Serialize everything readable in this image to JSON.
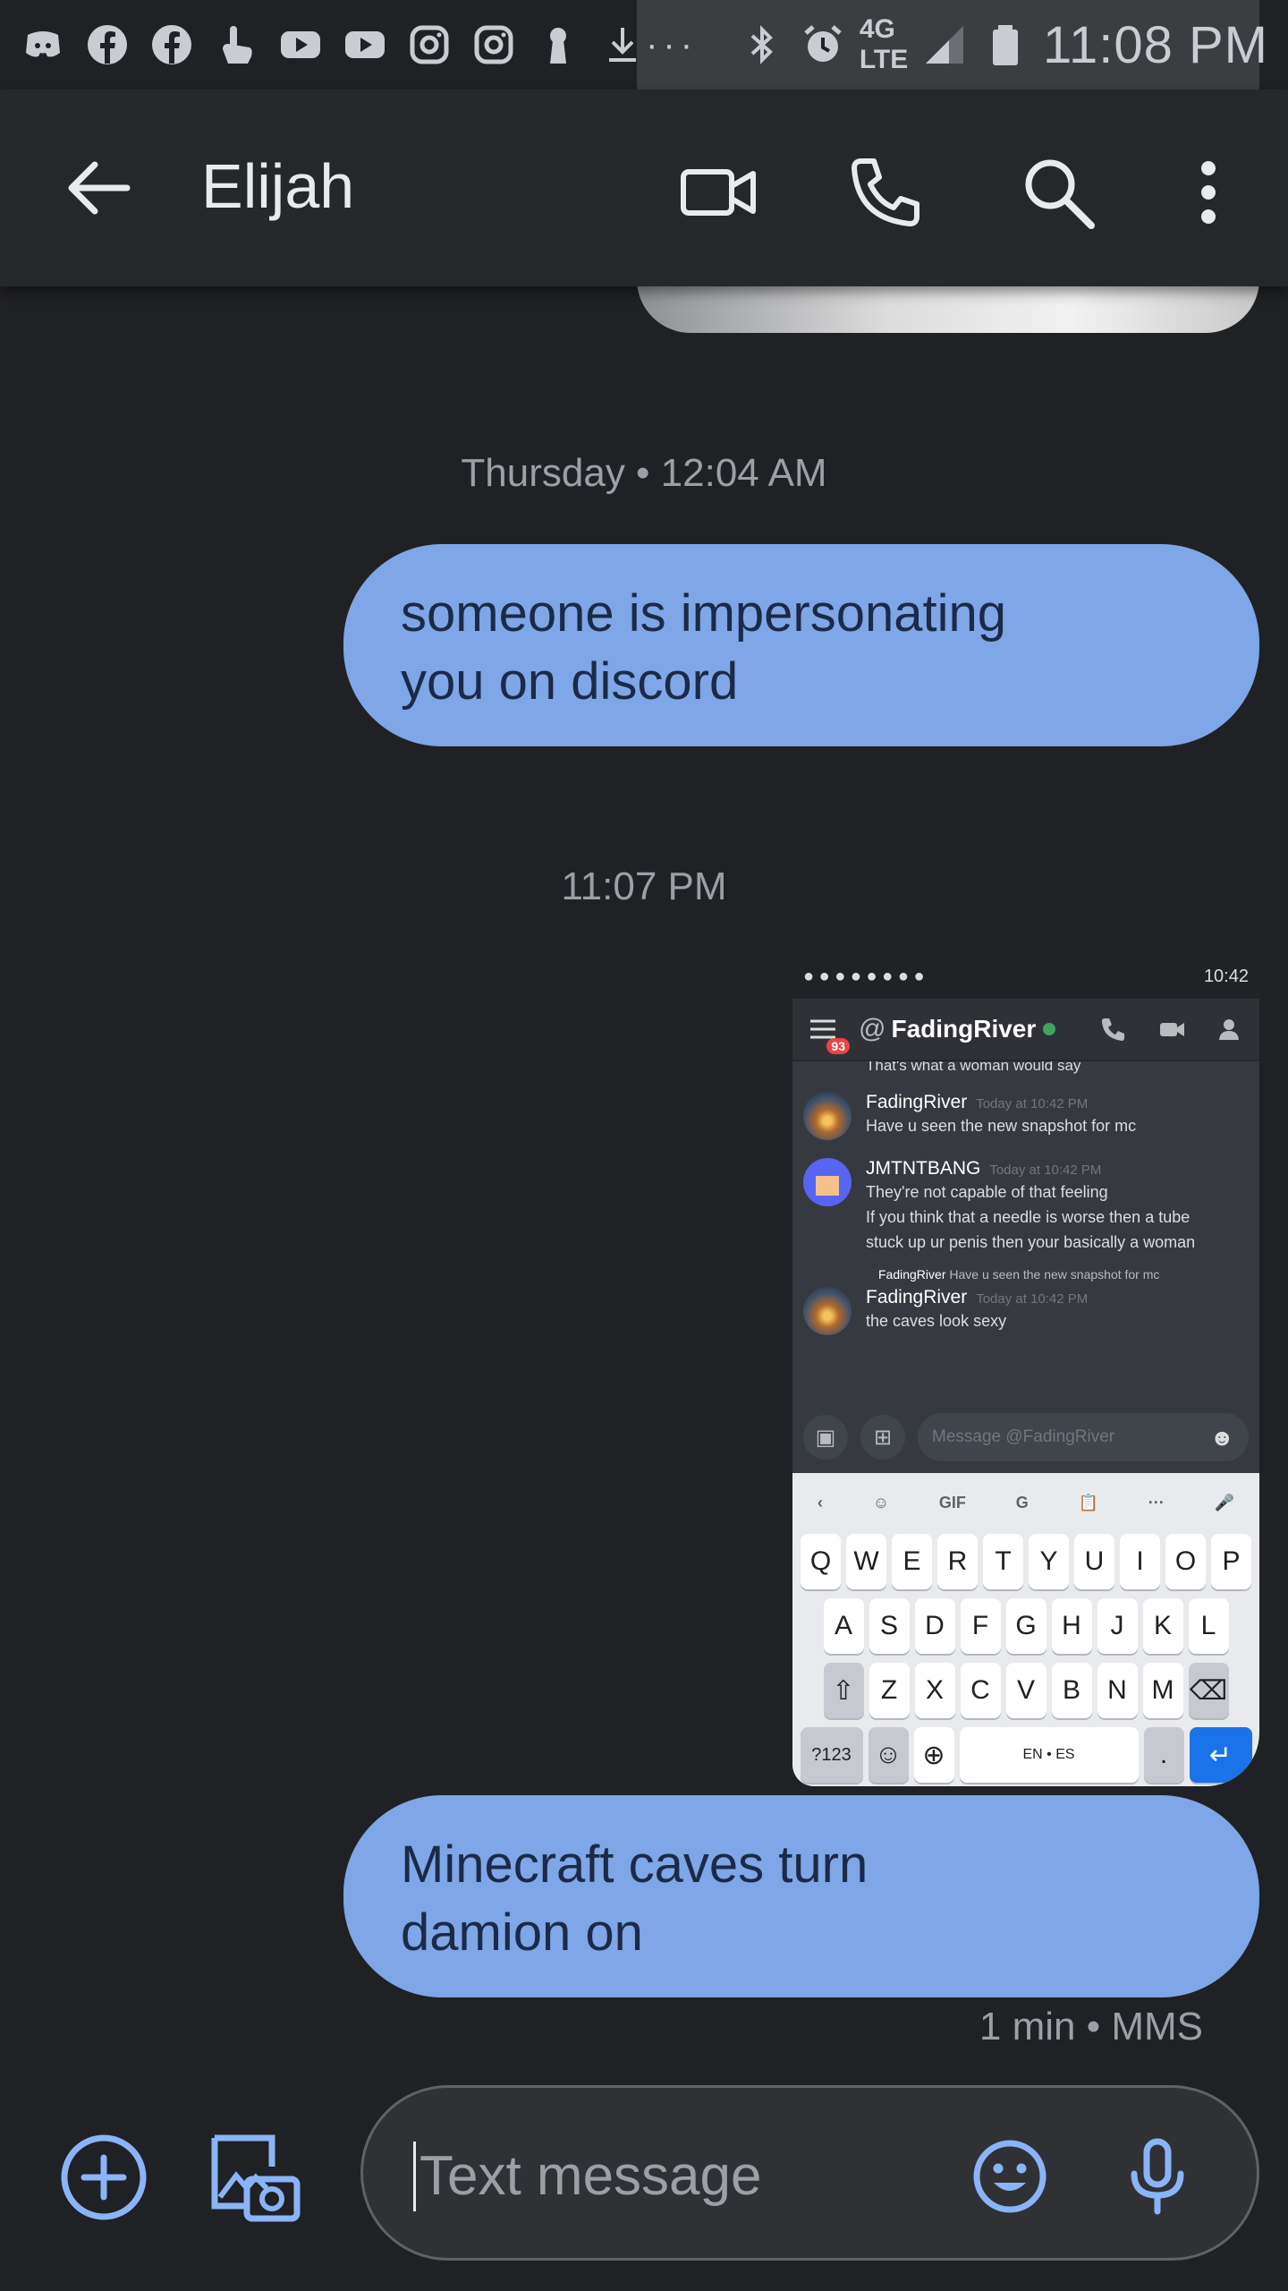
{
  "status_bar": {
    "time": "11:08 PM",
    "network": "4G LTE",
    "overflow": "···",
    "icons": [
      "discord-icon",
      "facebook-icon",
      "facebook-icon",
      "touch-icon",
      "youtube-icon",
      "youtube-icon",
      "instagram-icon",
      "instagram-icon",
      "keyhole-icon",
      "download-icon",
      "bluetooth-icon",
      "alarm-icon",
      "signal-icon",
      "battery-icon"
    ]
  },
  "header": {
    "contact_name": "Elijah",
    "actions": [
      "video-call-icon",
      "phone-icon",
      "search-icon",
      "more-vert-icon"
    ]
  },
  "conversation": {
    "timestamp_1": "Thursday • 12:04 AM",
    "message_1": "someone is impersonating\nyou on discord",
    "timestamp_2": "11:07 PM",
    "message_2": "Minecraft caves turn\ndamion on",
    "message_2_meta": "1 min • MMS"
  },
  "screenshot": {
    "status_time": "10:42",
    "badge": "93",
    "channel": "FadingRiver",
    "cut_line": "That's what a woman would say",
    "messages": [
      {
        "author": "FadingRiver",
        "time": "Today at 10:42 PM",
        "text": "Have u seen the new snapshot for mc"
      },
      {
        "author": "JMTNTBANG",
        "time": "Today at 10:42 PM",
        "text": "They're not capable of that feeling\nIf you think that a needle is worse then a tube\nstuck up ur penis then your basically a woman"
      }
    ],
    "reply_author": "FadingRiver",
    "reply_text": "Have u seen the new snapshot for mc",
    "last_author": "FadingRiver",
    "last_time": "Today at 10:42 PM",
    "last_text": "the caves look sexy",
    "input_placeholder": "Message @FadingRiver",
    "keyboard": {
      "tools": [
        "‹",
        "☺",
        "GIF",
        "G",
        "📋",
        "···",
        "🎤"
      ],
      "row1": [
        "Q",
        "W",
        "E",
        "R",
        "T",
        "Y",
        "U",
        "I",
        "O",
        "P"
      ],
      "row2": [
        "A",
        "S",
        "D",
        "F",
        "G",
        "H",
        "J",
        "K",
        "L"
      ],
      "row3": [
        "Z",
        "X",
        "C",
        "V",
        "B",
        "N",
        "M"
      ],
      "lang": "EN • ES",
      "num": "?123",
      "period": "."
    }
  },
  "compose": {
    "placeholder": "Text message"
  },
  "colors": {
    "background": "#202124",
    "bubble": "#7fa6e6",
    "accent": "#8ab4f8"
  }
}
